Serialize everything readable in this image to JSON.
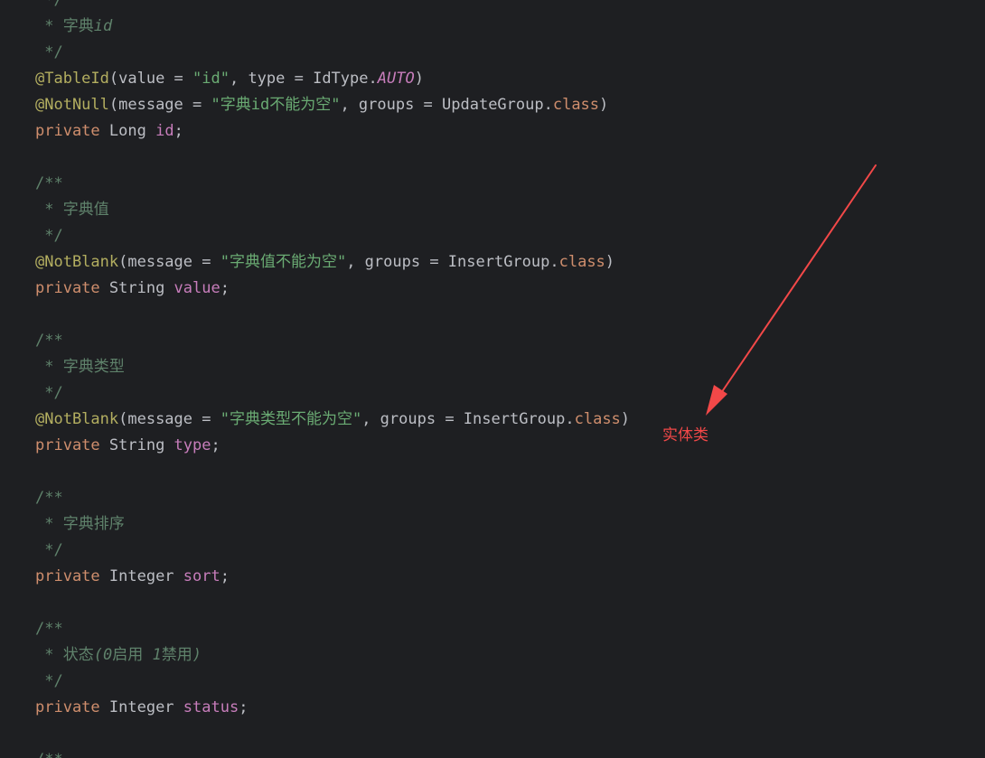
{
  "colors": {
    "background": "#1e1f22",
    "plain": "#bcbec4",
    "comment": "#5f826b",
    "annotation": "#b3ae60",
    "string": "#6aab73",
    "keyword": "#cf8e6d",
    "field": "#c77dbb",
    "callout": "#f24848"
  },
  "code_lines": [
    [
      {
        "t": "comment",
        "v": " */"
      }
    ],
    [
      {
        "t": "comment",
        "v": " * 字典"
      },
      {
        "t": "comment-italic",
        "v": "id"
      }
    ],
    [
      {
        "t": "comment",
        "v": " */"
      }
    ],
    [
      {
        "t": "annotation",
        "v": "@TableId"
      },
      {
        "t": "plain",
        "v": "(value = "
      },
      {
        "t": "string",
        "v": "\"id\""
      },
      {
        "t": "plain",
        "v": ", type = IdType."
      },
      {
        "t": "constant",
        "v": "AUTO"
      },
      {
        "t": "plain",
        "v": ")"
      }
    ],
    [
      {
        "t": "annotation",
        "v": "@NotNull"
      },
      {
        "t": "plain",
        "v": "(message = "
      },
      {
        "t": "string",
        "v": "\"字典id不能为空\""
      },
      {
        "t": "plain",
        "v": ", groups = UpdateGroup."
      },
      {
        "t": "keyword",
        "v": "class"
      },
      {
        "t": "plain",
        "v": ")"
      }
    ],
    [
      {
        "t": "keyword",
        "v": "private "
      },
      {
        "t": "plain",
        "v": "Long "
      },
      {
        "t": "field",
        "v": "id"
      },
      {
        "t": "plain",
        "v": ";"
      }
    ],
    [],
    [
      {
        "t": "comment",
        "v": "/**"
      }
    ],
    [
      {
        "t": "comment",
        "v": " * 字典值"
      }
    ],
    [
      {
        "t": "comment",
        "v": " */"
      }
    ],
    [
      {
        "t": "annotation",
        "v": "@NotBlank"
      },
      {
        "t": "plain",
        "v": "(message = "
      },
      {
        "t": "string",
        "v": "\"字典值不能为空\""
      },
      {
        "t": "plain",
        "v": ", groups = InsertGroup."
      },
      {
        "t": "keyword",
        "v": "class"
      },
      {
        "t": "plain",
        "v": ")"
      }
    ],
    [
      {
        "t": "keyword",
        "v": "private "
      },
      {
        "t": "plain",
        "v": "String "
      },
      {
        "t": "field",
        "v": "value"
      },
      {
        "t": "plain",
        "v": ";"
      }
    ],
    [],
    [
      {
        "t": "comment",
        "v": "/**"
      }
    ],
    [
      {
        "t": "comment",
        "v": " * 字典类型"
      }
    ],
    [
      {
        "t": "comment",
        "v": " */"
      }
    ],
    [
      {
        "t": "annotation",
        "v": "@NotBlank"
      },
      {
        "t": "plain",
        "v": "(message = "
      },
      {
        "t": "string",
        "v": "\"字典类型不能为空\""
      },
      {
        "t": "plain",
        "v": ", groups = InsertGroup."
      },
      {
        "t": "keyword",
        "v": "class"
      },
      {
        "t": "plain",
        "v": ")"
      }
    ],
    [
      {
        "t": "keyword",
        "v": "private "
      },
      {
        "t": "plain",
        "v": "String "
      },
      {
        "t": "field",
        "v": "type"
      },
      {
        "t": "plain",
        "v": ";"
      }
    ],
    [],
    [
      {
        "t": "comment",
        "v": "/**"
      }
    ],
    [
      {
        "t": "comment",
        "v": " * 字典排序"
      }
    ],
    [
      {
        "t": "comment",
        "v": " */"
      }
    ],
    [
      {
        "t": "keyword",
        "v": "private "
      },
      {
        "t": "plain",
        "v": "Integer "
      },
      {
        "t": "field",
        "v": "sort"
      },
      {
        "t": "plain",
        "v": ";"
      }
    ],
    [],
    [
      {
        "t": "comment",
        "v": "/**"
      }
    ],
    [
      {
        "t": "comment",
        "v": " * 状态"
      },
      {
        "t": "comment-italic",
        "v": "(0"
      },
      {
        "t": "comment",
        "v": "启用 "
      },
      {
        "t": "comment-italic",
        "v": "1"
      },
      {
        "t": "comment",
        "v": "禁用"
      },
      {
        "t": "comment-italic",
        "v": ")"
      }
    ],
    [
      {
        "t": "comment",
        "v": " */"
      }
    ],
    [
      {
        "t": "keyword",
        "v": "private "
      },
      {
        "t": "plain",
        "v": "Integer "
      },
      {
        "t": "field",
        "v": "status"
      },
      {
        "t": "plain",
        "v": ";"
      }
    ],
    [],
    [
      {
        "t": "comment",
        "v": "/**"
      }
    ]
  ],
  "callout": {
    "label": "实体类",
    "icon": "arrow-icon"
  }
}
